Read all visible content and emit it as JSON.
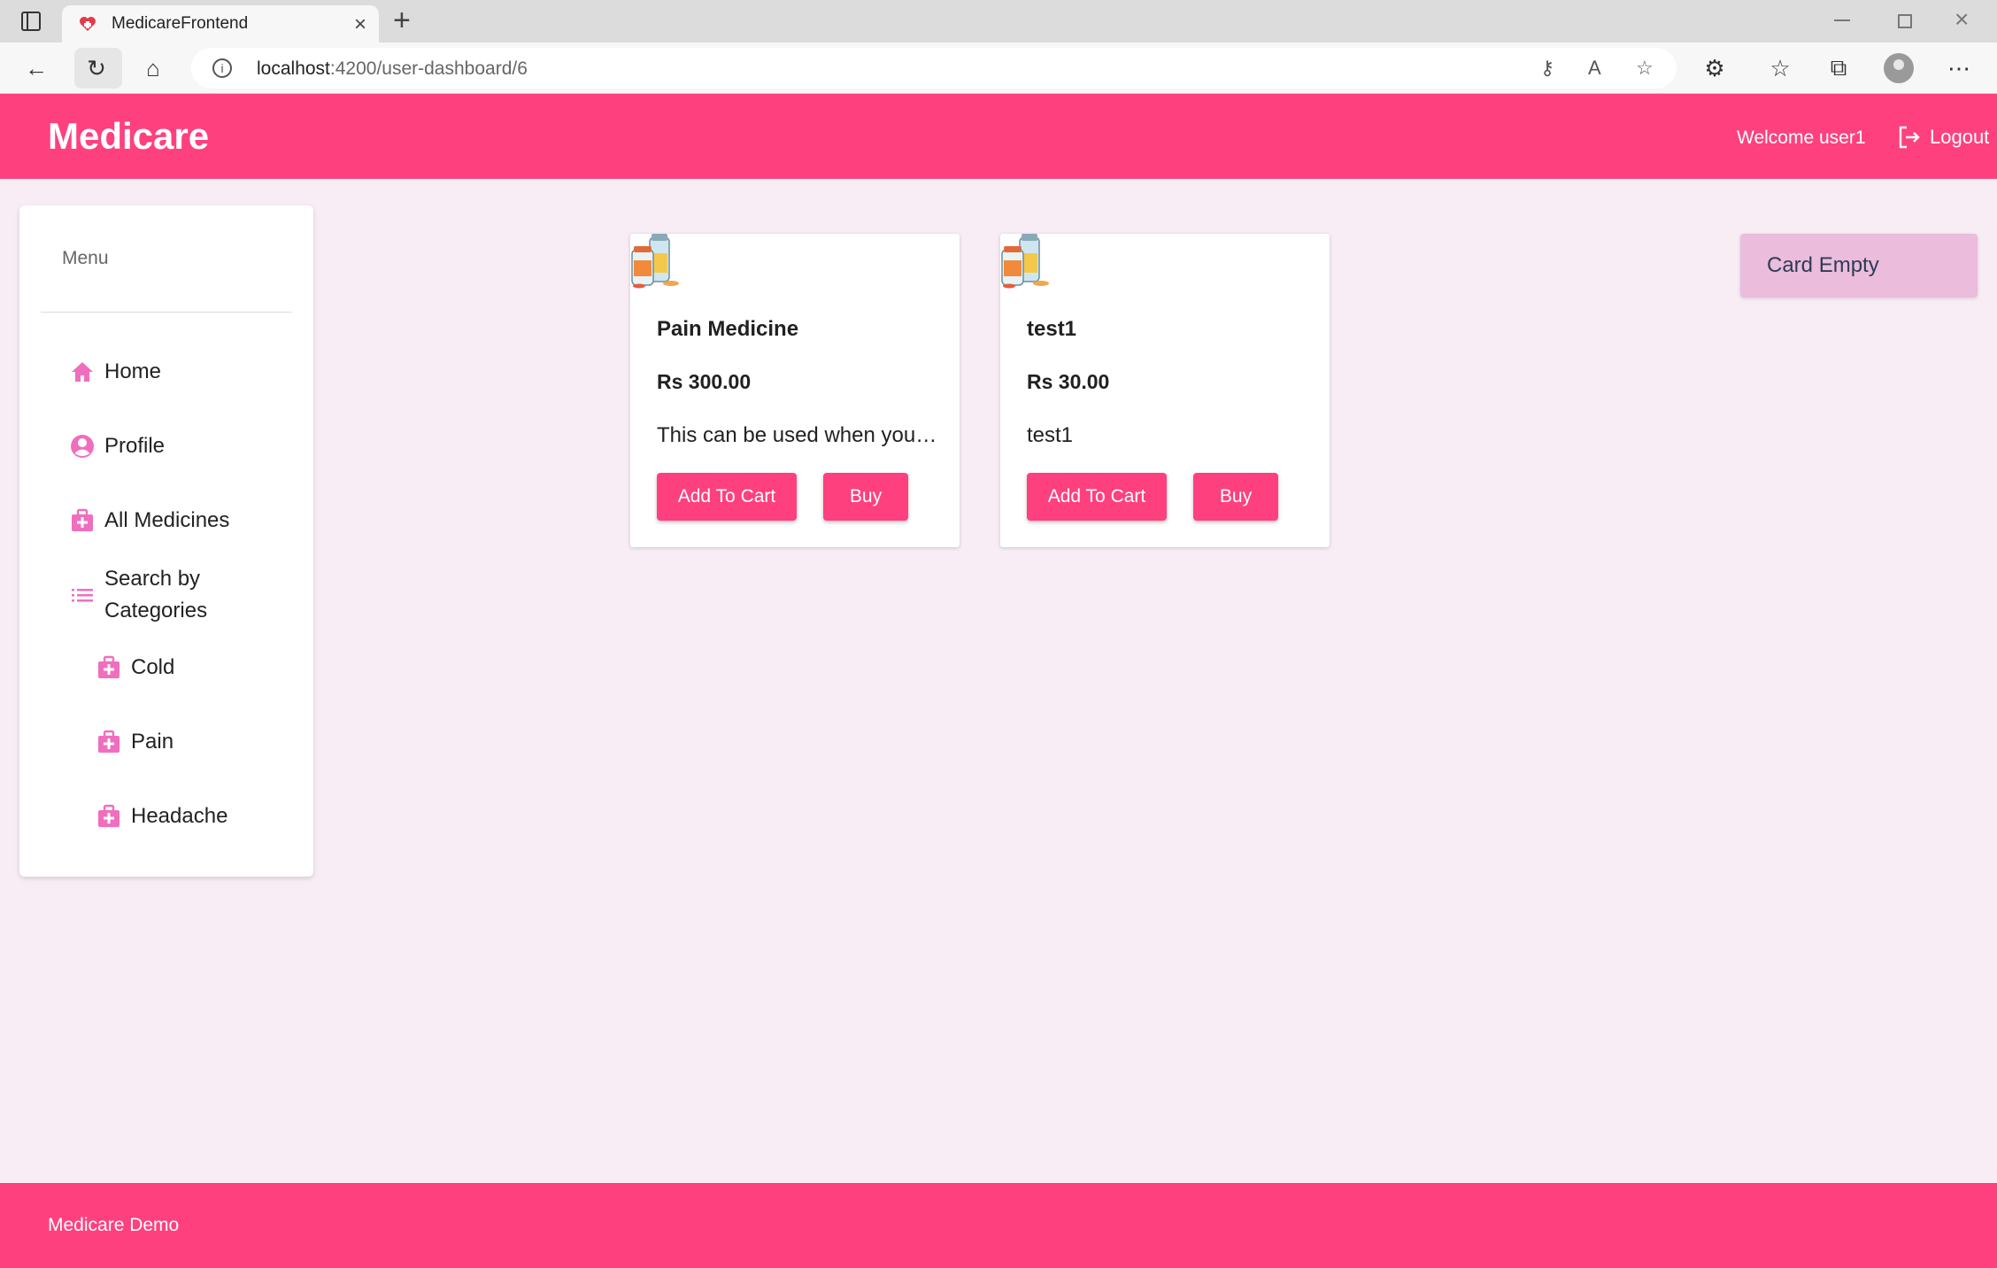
{
  "browser": {
    "tab_title": "MedicareFrontend",
    "url_host": "localhost",
    "url_path": ":4200/user-dashboard/6"
  },
  "header": {
    "brand": "Medicare",
    "welcome": "Welcome user1",
    "logout": "Logout"
  },
  "sidebar": {
    "title": "Menu",
    "items": [
      {
        "label": "Home",
        "icon": "home-icon"
      },
      {
        "label": "Profile",
        "icon": "account-circle-icon"
      },
      {
        "label": "All Medicines",
        "icon": "medical-bag-icon"
      },
      {
        "label": "Search by Categories",
        "label_line1": "Search by",
        "label_line2": "Categories",
        "icon": "list-icon"
      }
    ],
    "categories": [
      {
        "label": "Cold",
        "icon": "medical-bag-icon"
      },
      {
        "label": "Pain",
        "icon": "medical-bag-icon"
      },
      {
        "label": "Headache",
        "icon": "medical-bag-icon"
      }
    ]
  },
  "products": [
    {
      "name": "Pain Medicine",
      "price": "Rs 300.00",
      "description": "This can be used when you have pain",
      "add_label": "Add To Cart",
      "buy_label": "Buy"
    },
    {
      "name": "test1",
      "price": "Rs 30.00",
      "description": "test1",
      "add_label": "Add To Cart",
      "buy_label": "Buy"
    }
  ],
  "cart": {
    "status": "Card Empty"
  },
  "footer": {
    "text": "Medicare Demo"
  },
  "colors": {
    "primary": "#ff407f",
    "background": "#f8edf5",
    "icon": "#f06ebe",
    "cart_bg": "#ebbcdc"
  }
}
